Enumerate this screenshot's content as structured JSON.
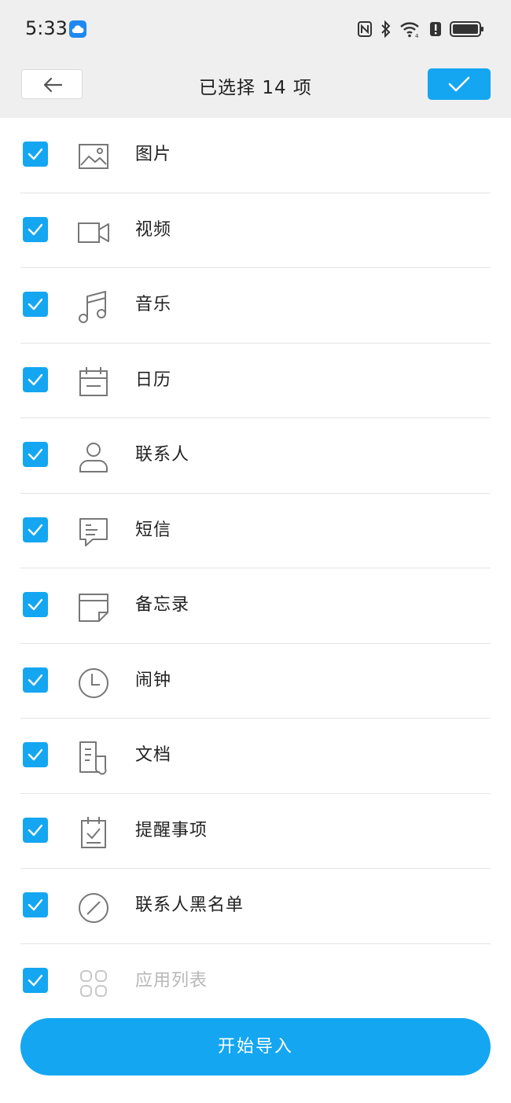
{
  "status": {
    "time": "5:33",
    "battery_badge": "!"
  },
  "header": {
    "title": "已选择 14 项"
  },
  "items": [
    {
      "label": "图片",
      "icon": "image-icon",
      "checked": true
    },
    {
      "label": "视频",
      "icon": "video-icon",
      "checked": true
    },
    {
      "label": "音乐",
      "icon": "music-icon",
      "checked": true
    },
    {
      "label": "日历",
      "icon": "calendar-icon",
      "checked": true
    },
    {
      "label": "联系人",
      "icon": "contact-icon",
      "checked": true
    },
    {
      "label": "短信",
      "icon": "message-icon",
      "checked": true
    },
    {
      "label": "备忘录",
      "icon": "note-icon",
      "checked": true
    },
    {
      "label": "闹钟",
      "icon": "clock-icon",
      "checked": true
    },
    {
      "label": "文档",
      "icon": "document-icon",
      "checked": true
    },
    {
      "label": "提醒事项",
      "icon": "reminder-icon",
      "checked": true
    },
    {
      "label": "联系人黑名单",
      "icon": "blocklist-icon",
      "checked": true
    },
    {
      "label": "应用列表",
      "icon": "apps-icon",
      "checked": true,
      "dimmed": true
    }
  ],
  "footer": {
    "import_label": "开始导入"
  },
  "colors": {
    "accent": "#14a6f1",
    "header_bg": "#efefef",
    "icon": "#777777"
  }
}
